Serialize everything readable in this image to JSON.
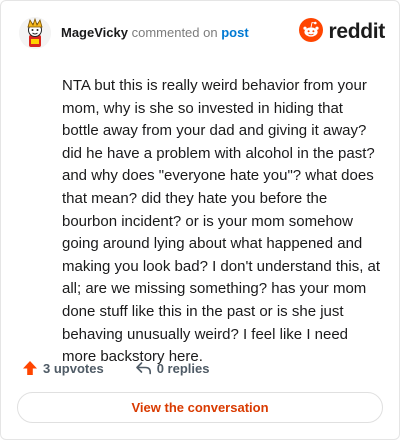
{
  "comment": {
    "author": "MageVicky",
    "action_text": "commented on",
    "post_link": "post",
    "body": "NTA but this is really weird behavior from your mom, why is she so invested in hiding that bottle away from your dad and giving it away? did he have a problem with alcohol in the past? and why does \"everyone hate you\"? what does that mean? did they hate you before the bourbon incident? or is your mom somehow going around lying about what happened and making you look bad? I don't understand this, at all; are we missing something? has your mom done stuff like this in the past or is she just behaving unusually weird? I feel like I need more backstory here."
  },
  "brand": {
    "name": "reddit",
    "icon": "reddit-logo-icon"
  },
  "actions": {
    "upvotes": "3 upvotes",
    "replies": "0 replies",
    "upvote_icon": "upvote-arrow-icon",
    "reply_icon": "reply-arrow-icon"
  },
  "view_button": "View the conversation",
  "colors": {
    "brand_orange": "#ff4500",
    "link_blue": "#0079d3",
    "button_text": "#d93a00"
  }
}
